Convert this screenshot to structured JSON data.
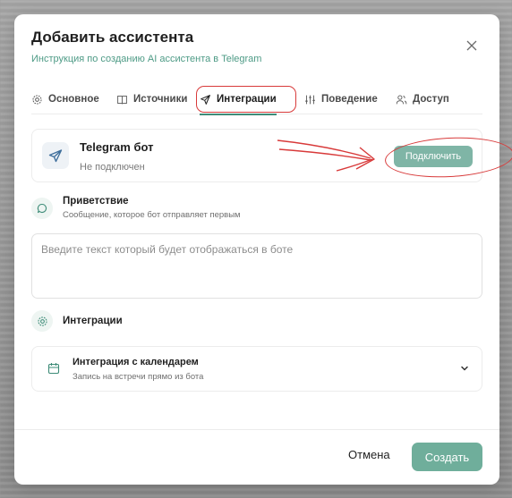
{
  "dialog": {
    "title": "Добавить ассистента",
    "subtitle_link": "Инструкция по созданию AI ассистента в Telegram"
  },
  "tabs": [
    {
      "label": "Основное",
      "icon": "gear-icon"
    },
    {
      "label": "Источники",
      "icon": "book-icon"
    },
    {
      "label": "Интеграции",
      "icon": "send-icon",
      "active": true
    },
    {
      "label": "Поведение",
      "icon": "sliders-icon"
    },
    {
      "label": "Доступ",
      "icon": "users-icon"
    }
  ],
  "telegram": {
    "title": "Telegram бот",
    "status": "Не подключен",
    "connect_label": "Подключить"
  },
  "greeting": {
    "title": "Приветствие",
    "description": "Сообщение, которое бот отправляет первым",
    "placeholder": "Введите текст который будет отображаться в боте",
    "value": ""
  },
  "integrations": {
    "title": "Интеграции",
    "calendar": {
      "title": "Интеграция с календарем",
      "description": "Запись на встречи прямо из бота"
    }
  },
  "footer": {
    "cancel_label": "Отмена",
    "create_label": "Создать"
  },
  "colors": {
    "accent": "#3e8c78",
    "primary_button": "#6fae9b",
    "annotation": "#d83a3a"
  }
}
